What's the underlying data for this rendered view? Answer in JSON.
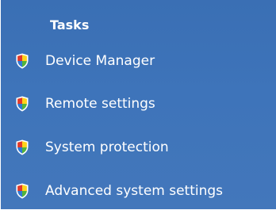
{
  "panel": {
    "title": "Tasks",
    "background": "#3e74ba",
    "text_color": "#ffffff"
  },
  "tasks": [
    {
      "label": "Device Manager",
      "icon": "uac-shield-icon"
    },
    {
      "label": "Remote settings",
      "icon": "uac-shield-icon"
    },
    {
      "label": "System protection",
      "icon": "uac-shield-icon"
    },
    {
      "label": "Advanced system settings",
      "icon": "uac-shield-icon"
    }
  ],
  "icon_colors": {
    "red": "#e23a2b",
    "yellow": "#ffd21a",
    "blue": "#2f78d6",
    "green": "#52b33c",
    "outline": "#ffffff"
  }
}
